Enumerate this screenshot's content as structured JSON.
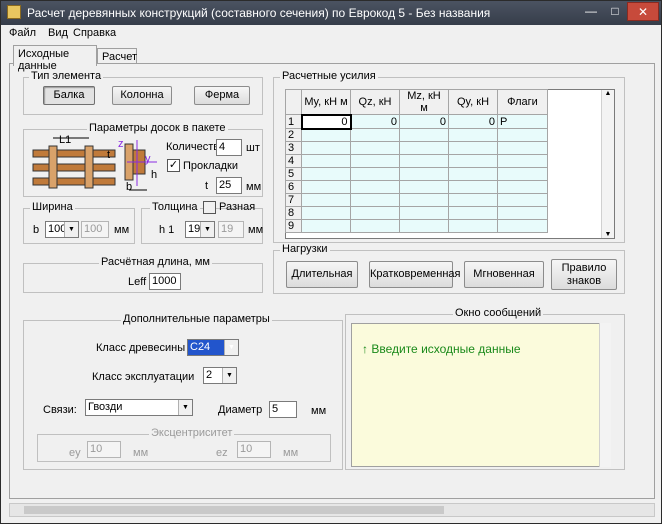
{
  "window": {
    "title": "Расчет деревянных конструкций (составного сечения) по Еврокод 5 - Без названия",
    "min": "—",
    "max": "□",
    "close": "✕"
  },
  "menu": [
    "Файл",
    "Вид",
    "Справка"
  ],
  "tabs": [
    "Исходные данные",
    "Расчет"
  ],
  "element_type": {
    "title": "Тип элемента",
    "buttons": [
      "Балка",
      "Колонна",
      "Ферма"
    ]
  },
  "boards": {
    "title": "Параметры досок в пакете",
    "qty_label": "Количество",
    "qty": "4",
    "qty_unit": "шт",
    "spacers_label": "Прокладки",
    "spacers_checked": "✓",
    "t_label": "t",
    "t_value": "25",
    "t_unit": "мм",
    "fig_l1": "L1",
    "fig_t": "t",
    "fig_b": "b",
    "fig_z": "z",
    "fig_y": "y",
    "fig_h": "h"
  },
  "width": {
    "title": "Ширина",
    "b_label": "b",
    "b_value": "100",
    "b_value2": "100",
    "unit": "мм"
  },
  "thickness": {
    "title": "Толщина",
    "varied_label": "Разная",
    "h1_label": "h 1",
    "h1_value": "19",
    "h1_value2": "19",
    "unit": "мм"
  },
  "length": {
    "title": "Расчётная длина, мм",
    "leff_label": "Leff",
    "leff_value": "1000"
  },
  "forces": {
    "title": "Расчетные усилия",
    "headers": [
      "My, кН м",
      "Qz, кН",
      "Mz, кН м",
      "Qy, кН",
      "Флаги"
    ],
    "rows": [
      [
        "1",
        "0",
        "0",
        "0",
        "0",
        "P"
      ],
      [
        "2",
        "",
        "",
        "",
        "",
        ""
      ],
      [
        "3",
        "",
        "",
        "",
        "",
        ""
      ],
      [
        "4",
        "",
        "",
        "",
        "",
        ""
      ],
      [
        "5",
        "",
        "",
        "",
        "",
        ""
      ],
      [
        "6",
        "",
        "",
        "",
        "",
        ""
      ],
      [
        "7",
        "",
        "",
        "",
        "",
        ""
      ],
      [
        "8",
        "",
        "",
        "",
        "",
        ""
      ],
      [
        "9",
        "",
        "",
        "",
        "",
        ""
      ]
    ]
  },
  "loads": {
    "title": "Нагрузки",
    "buttons": [
      "Длительная",
      "Кратковременная",
      "Мгновенная",
      "Правило знаков"
    ]
  },
  "extra": {
    "title": "Дополнительные параметры",
    "wood_class_label": "Класс древесины",
    "wood_class": "C24",
    "service_class_label": "Класс эксплуатации",
    "service_class": "2",
    "links_label": "Связи:",
    "links_value": "Гвозди",
    "diameter_label": "Диаметр",
    "diameter_value": "5",
    "diameter_unit": "мм",
    "ecc_title": "Эксцентриситет",
    "ey_label": "ey",
    "ey_value": "10",
    "ey_unit": "мм",
    "ez_label": "ez",
    "ez_value": "10",
    "ez_unit": "мм"
  },
  "messages": {
    "title": "Окно сообщений",
    "text": "↑ Введите исходные данные",
    "color": "#1a8a1a"
  }
}
